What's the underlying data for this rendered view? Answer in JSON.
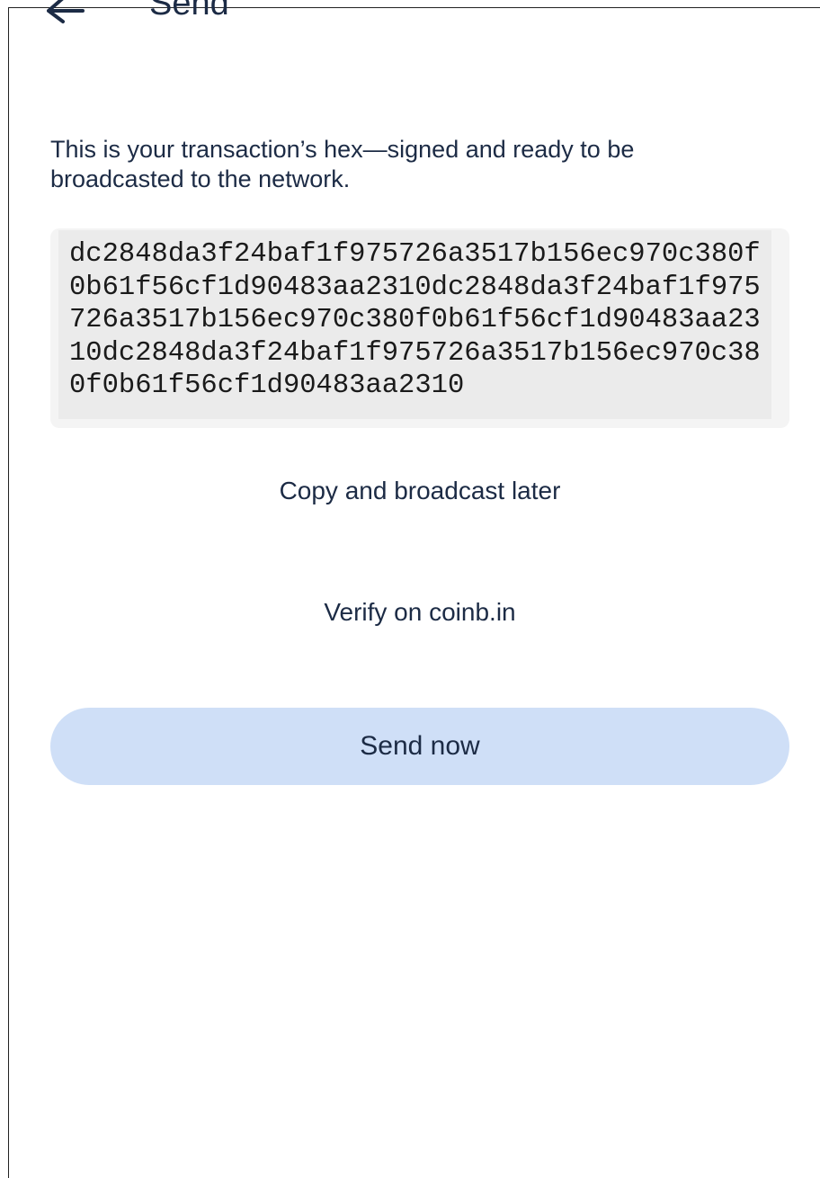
{
  "header": {
    "back_icon": "arrow-left-icon",
    "title": "Send"
  },
  "description": "This is your transaction’s hex—signed and ready to be broadcasted to the network.",
  "transaction_hex": "dc2848da3f24baf1f975726a3517b156ec970c380f0b61f56cf1d90483aa2310dc2848da3f24baf1f975726a3517b156ec970c380f0b61f56cf1d90483aa2310dc2848da3f24baf1f975726a3517b156ec970c380f0b61f56cf1d90483aa2310",
  "actions": {
    "copy_label": "Copy and broadcast later",
    "verify_label": "Verify on coinb.in",
    "send_label": "Send now"
  },
  "colors": {
    "text": "#1c2b45",
    "hex_background": "#ebebeb",
    "primary_button": "#cfdff7"
  }
}
